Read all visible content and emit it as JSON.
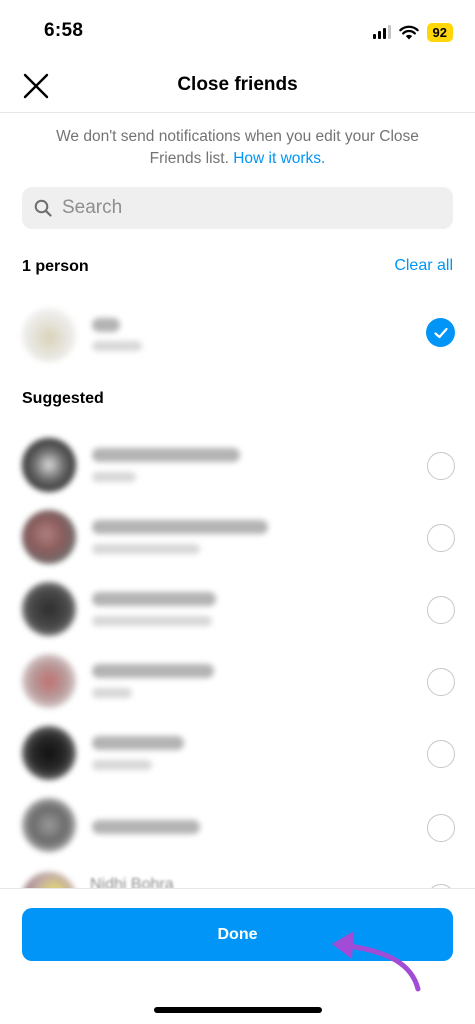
{
  "status_bar": {
    "time": "6:58",
    "battery": "92"
  },
  "header": {
    "title": "Close friends"
  },
  "notice": {
    "text": "We don't send notifications when you edit your Close Friends list.",
    "link": "How it works."
  },
  "search": {
    "placeholder": "Search",
    "value": ""
  },
  "selected": {
    "label": "1 person",
    "clear_label": "Clear all",
    "items": [
      {
        "checked": true
      }
    ]
  },
  "suggested": {
    "label": "Suggested",
    "partial_name": "Nidhi Bohra",
    "items": [
      {
        "checked": false
      },
      {
        "checked": false
      },
      {
        "checked": false
      },
      {
        "checked": false
      },
      {
        "checked": false
      },
      {
        "checked": false
      },
      {
        "checked": false
      }
    ]
  },
  "footer": {
    "done_label": "Done"
  },
  "colors": {
    "accent": "#0095f6",
    "battery": "#ffd60a",
    "arrow": "#a24bd6"
  },
  "icons": [
    "close-icon",
    "search-icon",
    "check-icon",
    "wifi-icon",
    "signal-icon"
  ]
}
